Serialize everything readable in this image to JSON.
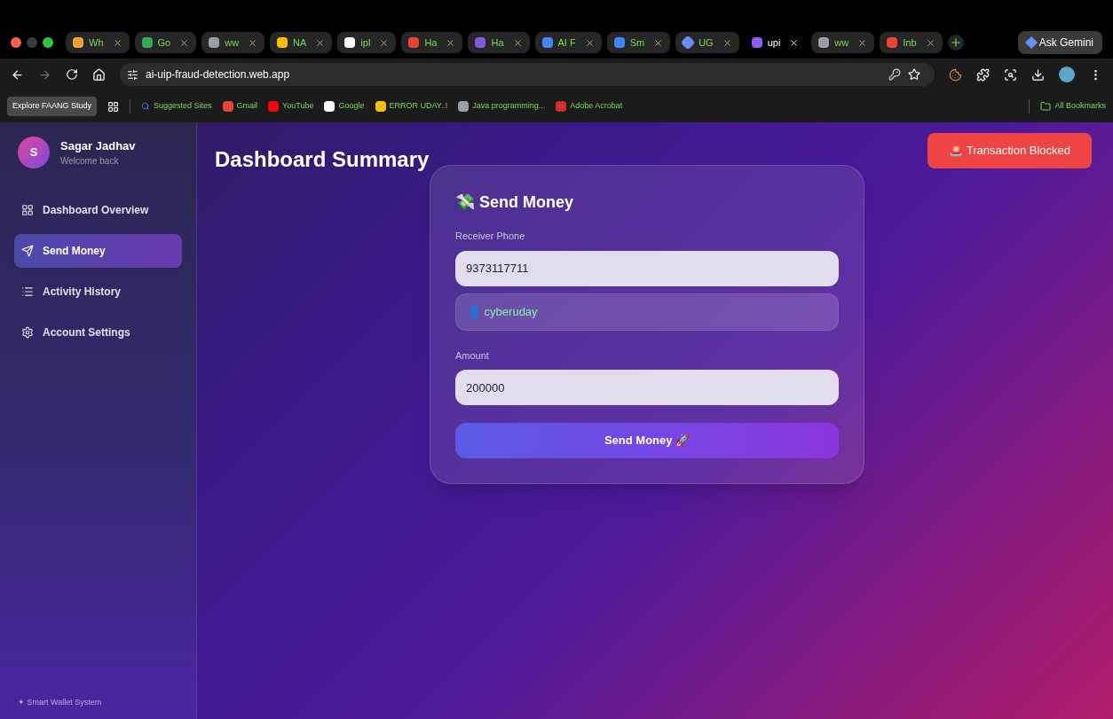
{
  "browser": {
    "tabs": [
      {
        "title": "Wh",
        "kind": "crown",
        "selected": false
      },
      {
        "title": "Go",
        "kind": "meet",
        "selected": false
      },
      {
        "title": "ww",
        "kind": "globe",
        "selected": false
      },
      {
        "title": "NA",
        "kind": "drive",
        "selected": false
      },
      {
        "title": "ipl",
        "kind": "google",
        "selected": false
      },
      {
        "title": "Ha",
        "kind": "gmail",
        "selected": false
      },
      {
        "title": "Ha",
        "kind": "sheet",
        "selected": false
      },
      {
        "title": "AI F",
        "kind": "doc",
        "selected": false
      },
      {
        "title": "Sm",
        "kind": "doc",
        "selected": false
      },
      {
        "title": "UG",
        "kind": "gemini",
        "selected": false
      },
      {
        "title": "upi",
        "kind": "bolt",
        "selected": true
      },
      {
        "title": "ww",
        "kind": "globe",
        "selected": false
      },
      {
        "title": "Inb",
        "kind": "gmail",
        "selected": false
      }
    ],
    "ask_button": "Ask Gemini",
    "url": "ai-uip-fraud-detection.web.app",
    "bookmarks": [
      {
        "label": "Explore FAANG Study",
        "kind": "chip"
      },
      {
        "label": "Suggested Sites",
        "kind": "search"
      },
      {
        "label": "Gmail",
        "kind": "gmail"
      },
      {
        "label": "YouTube",
        "kind": "youtube"
      },
      {
        "label": "Google",
        "kind": "google"
      },
      {
        "label": "ERROR UDAY..!",
        "kind": "drive"
      },
      {
        "label": "Java programming...",
        "kind": "globe"
      },
      {
        "label": "Adobe Acrobat",
        "kind": "acrobat"
      }
    ],
    "all_bookmarks": "All Bookmarks"
  },
  "sidebar": {
    "avatar": "S",
    "user_name": "Sagar Jadhav",
    "greeting": "Welcome back",
    "items": [
      {
        "label": "Dashboard Overview",
        "kind": "grid",
        "selected": false
      },
      {
        "label": "Send Money",
        "kind": "send",
        "selected": true
      },
      {
        "label": "Activity History",
        "kind": "list",
        "selected": false
      },
      {
        "label": "Account Settings",
        "kind": "gear",
        "selected": false
      }
    ],
    "footer": "✦ Smart Wallet System"
  },
  "main": {
    "title": "Dashboard Summary",
    "alert_button": "🚨 Transaction Blocked",
    "card": {
      "title": "💸 Send Money",
      "phone_label": "Receiver Phone",
      "phone_value": "9373117711",
      "receiver": "👤 cyberuday",
      "amount_label": "Amount",
      "amount_value": "200000",
      "submit": "Send Money 🚀"
    }
  }
}
